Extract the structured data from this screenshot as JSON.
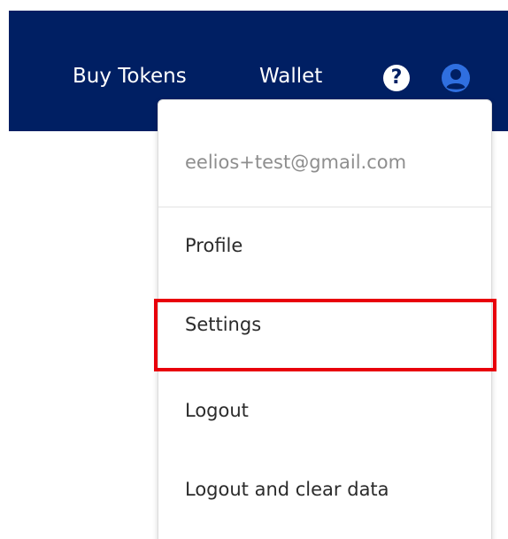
{
  "navbar": {
    "background_color": "#001f63",
    "buy_tokens_label": "Buy Tokens",
    "wallet_label": "Wallet",
    "help_icon": "question-circle-icon",
    "help_glyph": "?",
    "user_icon": "user-circle-icon",
    "user_icon_color": "#2f6fe0"
  },
  "dropdown": {
    "email": "eelios+test@gmail.com",
    "items": [
      {
        "label": "Profile"
      },
      {
        "label": "Settings",
        "highlighted": true
      },
      {
        "label": "Logout"
      },
      {
        "label": "Logout and clear data"
      }
    ]
  },
  "highlight_color": "#e8000b"
}
